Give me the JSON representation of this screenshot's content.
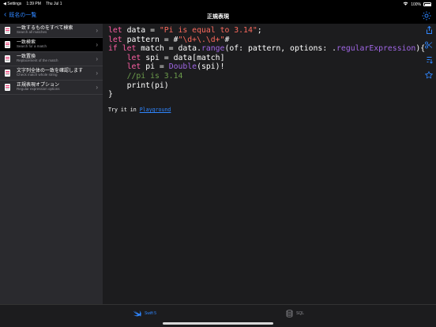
{
  "status": {
    "back_app": "◀ Settings",
    "time": "1:39 PM",
    "date": "Thu Jul 1",
    "battery": "100%"
  },
  "nav": {
    "back_label": "既名の一覧",
    "title": "正規表現"
  },
  "sidebar": {
    "items": [
      {
        "title": "一致するものをすべて検索",
        "subtitle": "Search all matches"
      },
      {
        "title": "一致検索",
        "subtitle": "Search for a match"
      },
      {
        "title": "一致置換",
        "subtitle": "Replacement of the match"
      },
      {
        "title": "文字列全体の一致を確認します",
        "subtitle": "Check match whole string"
      },
      {
        "title": "正規表現オプション",
        "subtitle": "Regular expression options"
      }
    ]
  },
  "code": {
    "try_prefix": "Try it in ",
    "try_link": "Playground"
  },
  "tabs": {
    "swift": "Swift 5",
    "sql": "SQL"
  },
  "colors": {
    "accent": "#2f86ff",
    "keyword": "#fc5fa3",
    "string": "#fc6a5d",
    "function": "#a167e6",
    "comment": "#6c9b4b"
  }
}
